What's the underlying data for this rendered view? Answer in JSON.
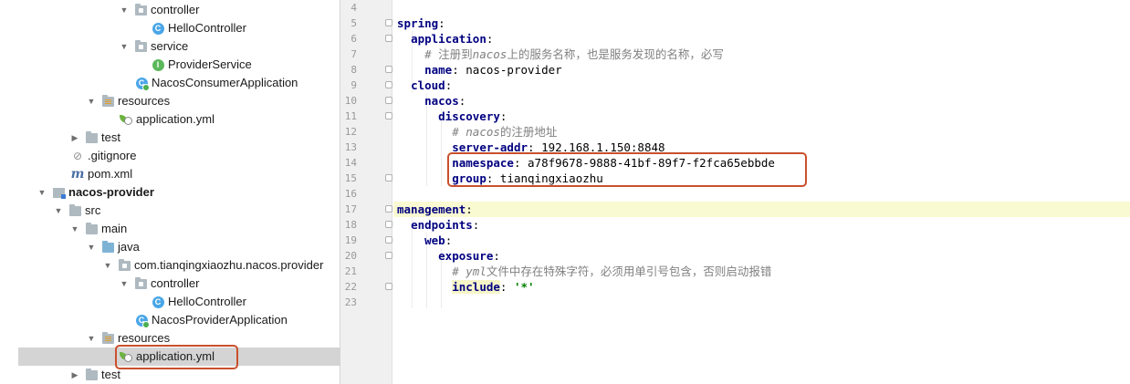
{
  "tree": {
    "rows": [
      {
        "label": "controller",
        "icon": "package-folder-icon"
      },
      {
        "label": "HelloController",
        "icon": "class-icon",
        "glyph": "C"
      },
      {
        "label": "service",
        "icon": "package-folder-icon"
      },
      {
        "label": "ProviderService",
        "icon": "interface-icon",
        "glyph": "I"
      },
      {
        "label": "NacosConsumerApplication",
        "icon": "spring-app-class-icon",
        "glyph": "C"
      },
      {
        "label": "resources",
        "icon": "resources-folder-icon"
      },
      {
        "label": "application.yml",
        "icon": "spring-yaml-icon"
      },
      {
        "label": "test",
        "icon": "folder-icon"
      },
      {
        "label": ".gitignore",
        "icon": "gitignore-icon"
      },
      {
        "label": "pom.xml",
        "icon": "maven-icon",
        "glyph": "m"
      },
      {
        "label": "nacos-provider",
        "icon": "module-icon"
      },
      {
        "label": "src",
        "icon": "folder-icon"
      },
      {
        "label": "main",
        "icon": "folder-icon"
      },
      {
        "label": "java",
        "icon": "source-folder-icon"
      },
      {
        "label": "com.tianqingxiaozhu.nacos.provider",
        "icon": "package-folder-icon"
      },
      {
        "label": "controller",
        "icon": "package-folder-icon"
      },
      {
        "label": "HelloController",
        "icon": "class-icon",
        "glyph": "C"
      },
      {
        "label": "NacosProviderApplication",
        "icon": "spring-app-class-icon",
        "glyph": "C"
      },
      {
        "label": "resources",
        "icon": "resources-folder-icon"
      },
      {
        "label": "application.yml",
        "icon": "spring-yaml-icon"
      },
      {
        "label": "test",
        "icon": "folder-icon"
      }
    ],
    "expanded_arrow": "▼",
    "collapsed_arrow": "▶"
  },
  "editor": {
    "line_numbers": [
      "4",
      "5",
      "6",
      "7",
      "8",
      "9",
      "10",
      "11",
      "12",
      "13",
      "14",
      "15",
      "16",
      "17",
      "18",
      "19",
      "20",
      "21",
      "22",
      "23"
    ],
    "code": {
      "l5_key": "spring",
      "l6_key": "application",
      "l7_comment_prefix": "# 注册到",
      "l7_comment_italic": "nacos",
      "l7_comment_suffix": "上的服务名称，也是服务发现的名称，必写",
      "l8_key": "name",
      "l8_value": "nacos-provider",
      "l9_key": "cloud",
      "l10_key": "nacos",
      "l11_key": "discovery",
      "l12_comment_prefix": "# ",
      "l12_comment_italic": "nacos",
      "l12_comment_suffix": "的注册地址",
      "l13_key": "server-addr",
      "l13_value": "192.168.1.150:8848",
      "l14_key": "namespace",
      "l14_value": "a78f9678-9888-41bf-89f7-f2fca65ebbde",
      "l15_key": "group",
      "l15_value": "tianqingxiaozhu",
      "l17_key": "management",
      "l18_key": "endpoints",
      "l19_key": "web",
      "l20_key": "exposure",
      "l21_comment_prefix": "# ",
      "l21_comment_italic": "yml",
      "l21_comment_suffix": "文件中存在特殊字符，必须用单引号包含，否则启动报错",
      "l22_key": "include",
      "l22_value": "'*'",
      "colon": ":"
    }
  },
  "colors": {
    "key": "#000080",
    "string": "#008000",
    "comment": "#808080",
    "highlight_box": "#c9502c",
    "current_line": "#fafad2"
  }
}
